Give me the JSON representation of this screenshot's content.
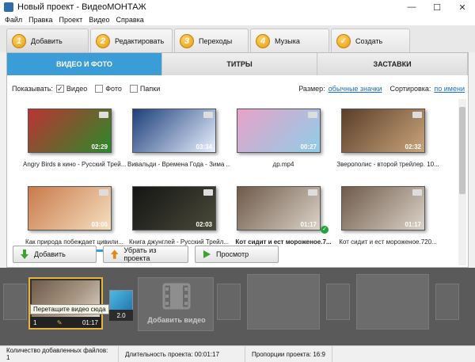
{
  "window": {
    "title": "Новый проект - ВидеоМОНТАЖ",
    "minimize": "—",
    "maximize": "☐",
    "close": "✕"
  },
  "menu": [
    "Файл",
    "Правка",
    "Проект",
    "Видео",
    "Справка"
  ],
  "steps": [
    {
      "num": "1",
      "label": "Добавить",
      "active": true
    },
    {
      "num": "2",
      "label": "Редактировать"
    },
    {
      "num": "3",
      "label": "Переходы"
    },
    {
      "num": "4",
      "label": "Музыка"
    },
    {
      "num": "✓",
      "label": "Создать"
    }
  ],
  "subtabs": [
    "ВИДЕО И ФОТО",
    "ТИТРЫ",
    "ЗАСТАВКИ"
  ],
  "filter": {
    "show_label": "Показывать:",
    "video": "Видео",
    "photo": "Фото",
    "folders": "Папки",
    "size_label": "Размер:",
    "size_value": "обычные значки",
    "sort_label": "Сортировка:",
    "sort_value": "по имени"
  },
  "media": [
    {
      "caption": "Angry Birds в кино - Русский Трей...",
      "duration": "02:29",
      "thumb": "#b33",
      "thumb2": "#2a8a2a"
    },
    {
      "caption": "Вивальди - Времена Года - Зима ...",
      "duration": "03:34",
      "thumb": "#1d3f7a",
      "thumb2": "#e8f0ff"
    },
    {
      "caption": "др.mp4",
      "duration": "00:27",
      "thumb": "#e8a2c8",
      "thumb2": "#8fcde8"
    },
    {
      "caption": "Зверополис - второй трейлер. 10...",
      "duration": "02:32",
      "thumb": "#5a3e2a",
      "thumb2": "#caa57a"
    },
    {
      "caption": "Как природа побеждает цивили...",
      "duration": "03:06",
      "thumb": "#c97a4a",
      "thumb2": "#f5e0c0"
    },
    {
      "caption": "Книга джунглей - Русский Трейл...",
      "duration": "02:03",
      "thumb": "#141414",
      "thumb2": "#4a4a3a"
    },
    {
      "caption": "Кот сидит и ест мороженое.7...",
      "duration": "01:17",
      "thumb": "#6e5a4a",
      "thumb2": "#dcd3c8",
      "bold": true
    },
    {
      "caption": "Кот сидит и ест мороженое.720...",
      "duration": "01:17",
      "thumb": "#6e5a4a",
      "thumb2": "#dcd3c8"
    }
  ],
  "buttons": {
    "add": "Добавить",
    "remove": "Убрать из проекта",
    "preview": "Просмотр"
  },
  "timeline": {
    "clip_index": "1",
    "clip_duration": "01:17",
    "tooltip": "Перетащите видео сюда",
    "transition": "2.0",
    "add_video": "Добавить видео"
  },
  "status": {
    "files": "Количество добавленных файлов: 1",
    "duration": "Длительность проекта: 00:01:17",
    "ratio": "Пропорции проекта: 16:9"
  },
  "colors": {
    "accent": "#3b9dd7",
    "step_badge": "#e59a09",
    "clip_border": "#e7b43b",
    "timeline_bg": "#5a5a5a"
  }
}
